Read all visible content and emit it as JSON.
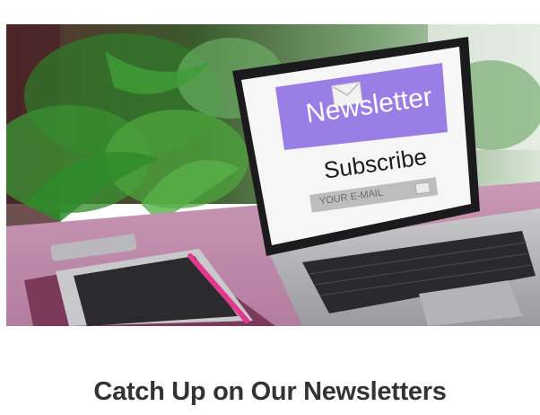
{
  "hero": {
    "screen_title": "Newsletter",
    "screen_subtitle": "Subscribe",
    "email_placeholder": "YOUR E-MAIL",
    "accent_color": "#9a7ee6",
    "icon": "envelope-icon"
  },
  "section": {
    "heading": "Catch Up on Our Newsletters"
  }
}
